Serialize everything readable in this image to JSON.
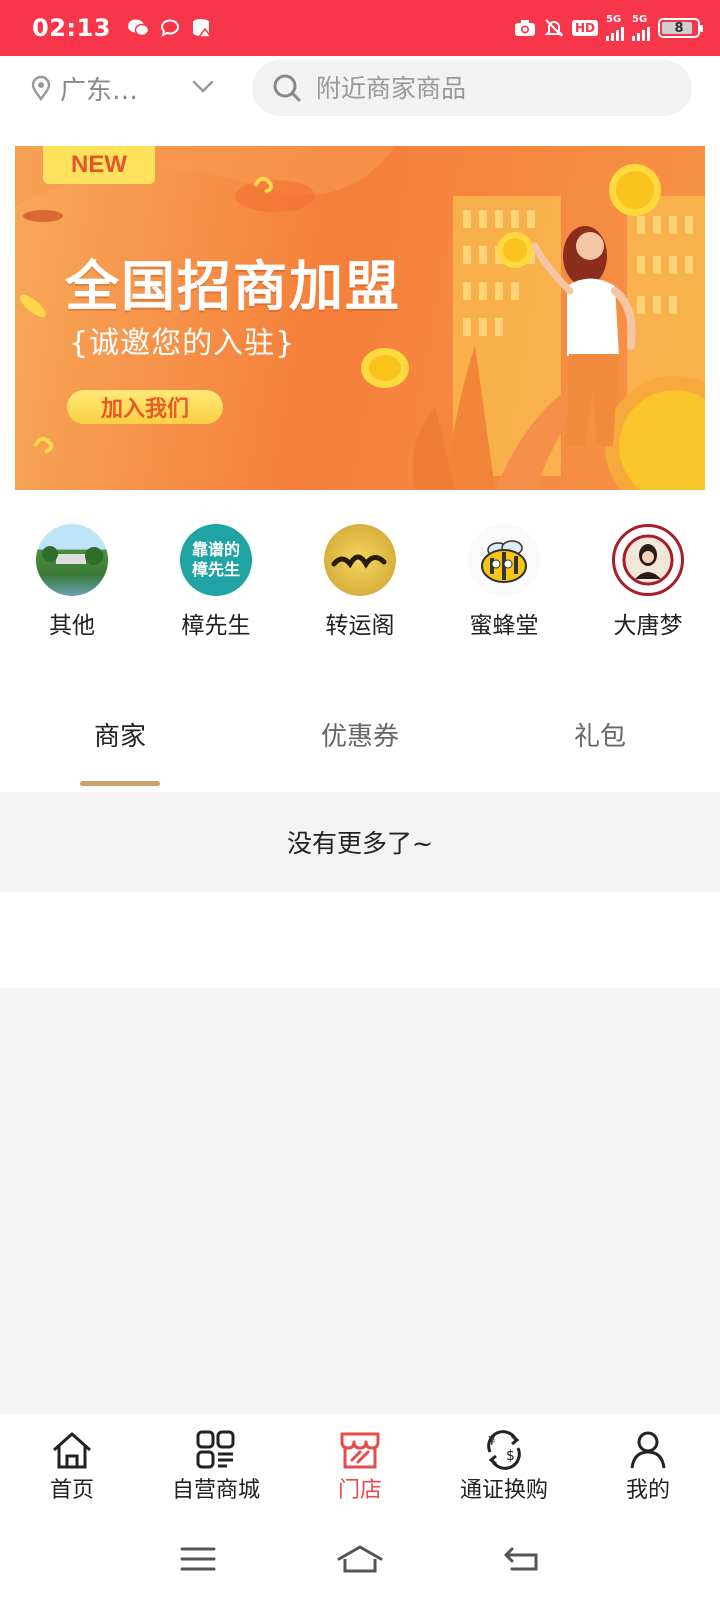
{
  "status_bar": {
    "time": "02:13",
    "network_labels": [
      "5G",
      "5G"
    ],
    "hd_label": "HD",
    "battery": "8"
  },
  "location": {
    "text": "广东…"
  },
  "search": {
    "placeholder": "附近商家商品"
  },
  "banner": {
    "badge": "NEW",
    "title": "全国招商加盟",
    "subtitle": "{诚邀您的入驻}",
    "button": "加入我们"
  },
  "categories": [
    {
      "label": "其他",
      "icon": "park-photo",
      "color": "#4a8f3c"
    },
    {
      "label": "樟先生",
      "icon": "brand-logo",
      "color": "#1fa3a3",
      "logo_text": "靠谱的 樟先生"
    },
    {
      "label": "转运阁",
      "icon": "brand-logo",
      "color": "#e8c24a"
    },
    {
      "label": "蜜蜂堂",
      "icon": "bee-logo",
      "color": "#f5c518"
    },
    {
      "label": "大唐梦",
      "icon": "seal-logo",
      "color": "#a51e2a"
    }
  ],
  "tabs": [
    {
      "label": "商家",
      "active": true
    },
    {
      "label": "优惠券",
      "active": false
    },
    {
      "label": "礼包",
      "active": false
    }
  ],
  "list_end_text": "没有更多了~",
  "bottom_nav": [
    {
      "label": "首页",
      "icon": "home-icon",
      "active": false
    },
    {
      "label": "自营商城",
      "icon": "grid-icon",
      "active": false
    },
    {
      "label": "门店",
      "icon": "store-icon",
      "active": true
    },
    {
      "label": "通证换购",
      "icon": "exchange-icon",
      "active": false
    },
    {
      "label": "我的",
      "icon": "user-icon",
      "active": false
    }
  ],
  "colors": {
    "accent": "#f7364a",
    "active_nav": "#e84a4a",
    "tab_indicator": "#c9a36b"
  }
}
